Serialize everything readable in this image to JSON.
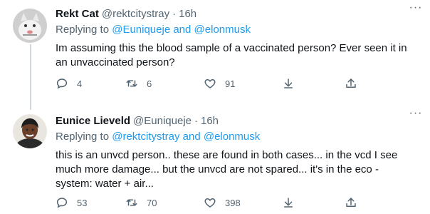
{
  "tweets": [
    {
      "name": "Rekt Cat",
      "handle": "@rektcitystray",
      "separator": "·",
      "time": "16h",
      "replying_prefix": "Replying to",
      "replying_user1": "@Euniqueje",
      "replying_and": "and",
      "replying_user2": "@elonmusk",
      "text_lines": [
        "Im assuming this the blood sample of a vaccinated person? Ever seen it in",
        "an unvaccinated person?"
      ],
      "counts": {
        "replies": "4",
        "retweets": "6",
        "likes": "91"
      }
    },
    {
      "name": "Eunice Lieveld",
      "handle": "@Euniqueje",
      "separator": "·",
      "time": "16h",
      "replying_prefix": "Replying to",
      "replying_user1": "@rektcitystray",
      "replying_and": "and",
      "replying_user2": "@elonmusk",
      "text_lines": [
        "this is an unvcd person.. these are found in both cases... in the vcd I see",
        "much more damage... but the unvcd are not spared... it's in the eco -",
        "system: water + air..."
      ],
      "counts": {
        "replies": "53",
        "retweets": "70",
        "likes": "398"
      }
    }
  ],
  "icons": {
    "more": "more-horizontal-icon",
    "reply": "reply-icon",
    "retweet": "retweet-icon",
    "like": "heart-icon",
    "share": "share-icon",
    "upload": "upload-icon"
  },
  "colors": {
    "link": "#1d9bf0",
    "muted": "#536471",
    "text": "#0f1419",
    "thread_line": "#cfd9de"
  }
}
